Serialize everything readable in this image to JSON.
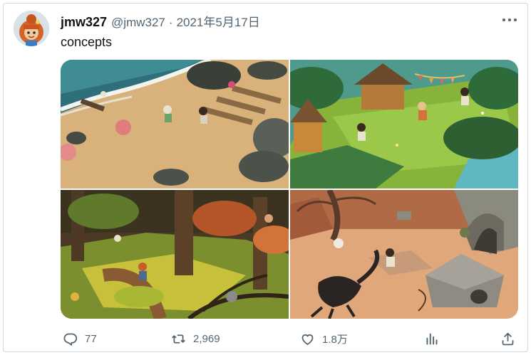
{
  "tweet": {
    "display_name": "jmw327",
    "handle": "@jmw327",
    "separator": "·",
    "date": "2021年5月17日",
    "text": "concepts"
  },
  "media": {
    "images": [
      {
        "scene": "beach"
      },
      {
        "scene": "village"
      },
      {
        "scene": "autumn-forest"
      },
      {
        "scene": "desert-ruins"
      }
    ]
  },
  "actions": {
    "reply": {
      "icon": "reply-icon",
      "count": "77"
    },
    "retweet": {
      "icon": "retweet-icon",
      "count": "2,969"
    },
    "like": {
      "icon": "heart-icon",
      "count": "1.8万"
    },
    "views": {
      "icon": "analytics-icon"
    },
    "share": {
      "icon": "share-icon"
    }
  },
  "colors": {
    "text_primary": "#0f1419",
    "text_secondary": "#536471",
    "border": "#cfd9de"
  }
}
